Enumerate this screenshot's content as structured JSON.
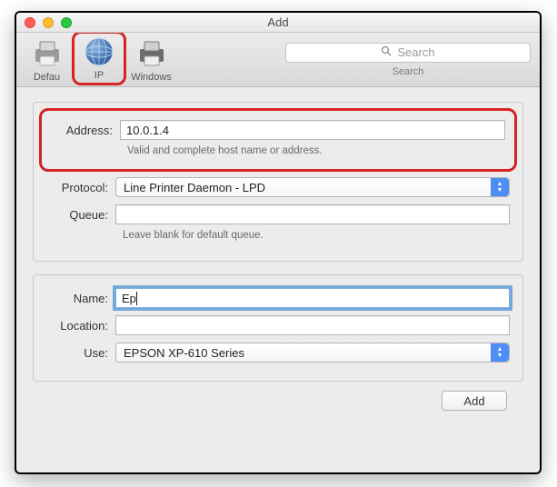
{
  "window": {
    "title": "Add"
  },
  "toolbar": {
    "items": [
      {
        "label": "Defau"
      },
      {
        "label": "IP"
      },
      {
        "label": "Windows"
      }
    ],
    "search": {
      "placeholder": "Search",
      "label": "Search"
    }
  },
  "form": {
    "address": {
      "label": "Address:",
      "value": "10.0.1.4",
      "help": "Valid and complete host name or address."
    },
    "protocol": {
      "label": "Protocol:",
      "value": "Line Printer Daemon - LPD"
    },
    "queue": {
      "label": "Queue:",
      "value": "",
      "help": "Leave blank for default queue."
    },
    "name": {
      "label": "Name:",
      "value": "Ep"
    },
    "location": {
      "label": "Location:",
      "value": ""
    },
    "use": {
      "label": "Use:",
      "value": "EPSON XP-610 Series"
    }
  },
  "buttons": {
    "add": "Add"
  }
}
